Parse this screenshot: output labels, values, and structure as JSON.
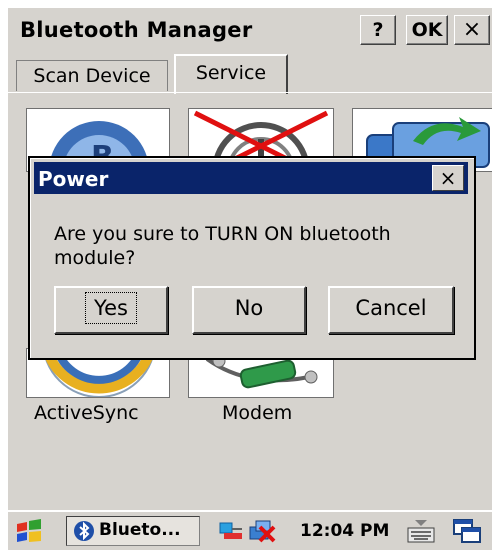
{
  "app": {
    "title": "Bluetooth Manager",
    "help_label": "?",
    "ok_label": "OK",
    "close_label": "×"
  },
  "tabs": [
    {
      "label": "Scan Device"
    },
    {
      "label": "Service"
    }
  ],
  "service_icons": [
    {
      "label": "ActiveSync",
      "icon": "activesync-icon"
    },
    {
      "label": "Modem",
      "icon": "modem-icon"
    }
  ],
  "dialog": {
    "title": "Power",
    "close_label": "×",
    "message": "Are you sure to TURN ON bluetooth module?",
    "buttons": {
      "yes": "Yes",
      "no": "No",
      "cancel": "Cancel"
    }
  },
  "taskbar": {
    "task_label": "Blueto...",
    "clock": "12:04 PM"
  },
  "colors": {
    "dialog_title_bar": "#0a246a",
    "window_face": "#d6d3ce"
  }
}
